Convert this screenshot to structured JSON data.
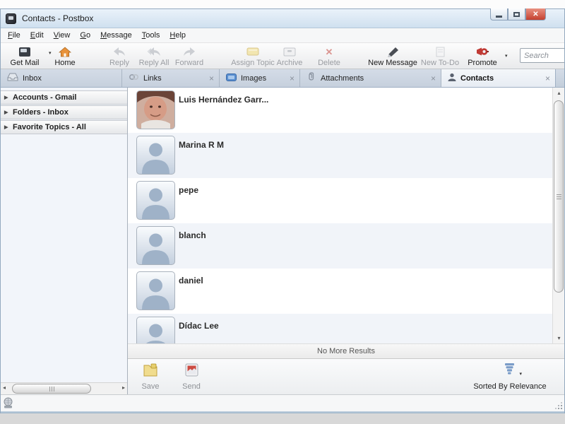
{
  "window": {
    "title": "Contacts - Postbox"
  },
  "menu": {
    "items": [
      "File",
      "Edit",
      "View",
      "Go",
      "Message",
      "Tools",
      "Help"
    ]
  },
  "toolbar": {
    "get_mail": "Get Mail",
    "home": "Home",
    "reply": "Reply",
    "reply_all": "Reply All",
    "forward": "Forward",
    "assign_topic": "Assign Topic",
    "archive": "Archive",
    "delete": "Delete",
    "new_message": "New Message",
    "new_todo": "New To-Do",
    "promote": "Promote",
    "search_placeholder": "Search"
  },
  "tabs": {
    "inbox": "Inbox",
    "links": "Links",
    "images": "Images",
    "attachments": "Attachments",
    "contacts": "Contacts",
    "active_tab": "Contacts"
  },
  "sidebar": {
    "sections": [
      "Accounts - Gmail",
      "Folders - Inbox",
      "Favorite Topics - All"
    ]
  },
  "contacts": [
    {
      "name": "Luis Hernández Garr...",
      "avatar": "photo"
    },
    {
      "name": "Marina R M",
      "avatar": "silhouette"
    },
    {
      "name": "pepe",
      "avatar": "silhouette"
    },
    {
      "name": "blanch",
      "avatar": "silhouette"
    },
    {
      "name": "daniel",
      "avatar": "silhouette"
    },
    {
      "name": "Dídac Lee",
      "avatar": "silhouette"
    }
  ],
  "results_bar": {
    "text": "No More Results"
  },
  "footer": {
    "save": "Save",
    "send": "Send",
    "sorted_by": "Sorted By Relevance"
  },
  "icons": {
    "dropdown_arrow": "▾",
    "close_tab": "×",
    "delete_x": "✕",
    "expand_triangle": "▶",
    "scroll_left": "◂",
    "scroll_right": "▸",
    "scroll_up": "▴",
    "scroll_down": "▾"
  },
  "colors": {
    "titlebar": "#d9e6f3",
    "tab_active": "#eef2f8",
    "tab_inactive": "#cbd5e2",
    "row_alt": "#f1f4f9",
    "close_button": "#c5402f",
    "accent_red": "#c4453c",
    "sort_icon_blue": "#7a9cc8"
  }
}
